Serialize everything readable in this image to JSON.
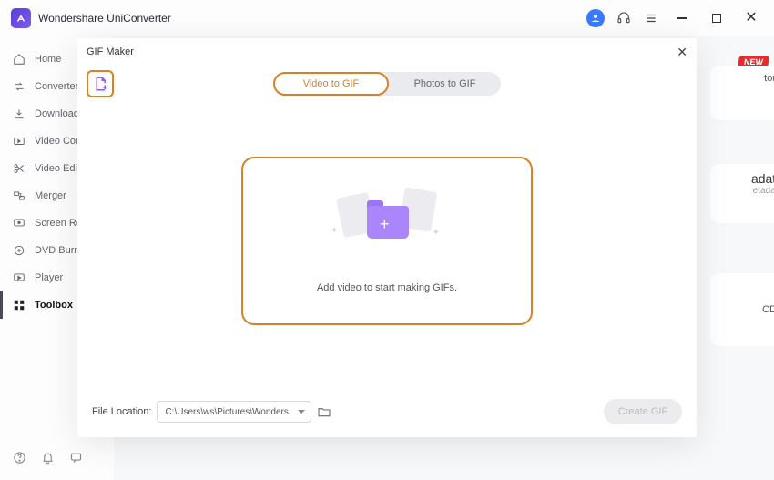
{
  "app": {
    "title": "Wondershare UniConverter"
  },
  "sidebar": {
    "items": [
      {
        "label": "Home"
      },
      {
        "label": "Converter"
      },
      {
        "label": "Downloader"
      },
      {
        "label": "Video Compress"
      },
      {
        "label": "Video Editor"
      },
      {
        "label": "Merger"
      },
      {
        "label": "Screen Recorder"
      },
      {
        "label": "DVD Burner"
      },
      {
        "label": "Player"
      },
      {
        "label": "Toolbox"
      }
    ]
  },
  "background": {
    "new_badge": "NEW",
    "metadata_title": "adata",
    "metadata_sub": "etadata",
    "cd_text": "CD."
  },
  "modal": {
    "title": "GIF Maker",
    "tabs": {
      "video": "Video to GIF",
      "photos": "Photos to GIF"
    },
    "dropzone_text": "Add video to start making GIFs.",
    "file_location_label": "File Location:",
    "file_location_value": "C:\\Users\\ws\\Pictures\\Wonders",
    "create_button": "Create GIF"
  }
}
